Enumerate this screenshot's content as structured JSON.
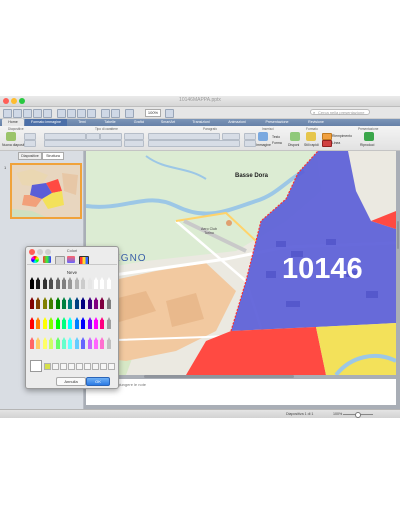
{
  "window": {
    "title": "10146MAPPA.pptx",
    "close_color": "#ff5f57",
    "minimize_color": "#febc2e",
    "zoom_color": "#28c840"
  },
  "toolbar": {
    "zoom_value": "100%",
    "search_placeholder": "Cerca nella presentazione",
    "search_icon": "search-icon"
  },
  "ribbon_tabs": [
    {
      "label": "Home",
      "state": "active"
    },
    {
      "label": "Formato immagine",
      "state": "selected"
    },
    {
      "label": "Temi",
      "state": "normal"
    },
    {
      "label": "Tabelle",
      "state": "normal"
    },
    {
      "label": "Grafici",
      "state": "normal"
    },
    {
      "label": "SmartArt",
      "state": "normal"
    },
    {
      "label": "Transizioni",
      "state": "normal"
    },
    {
      "label": "Animazioni",
      "state": "normal"
    },
    {
      "label": "Presentazione",
      "state": "normal"
    },
    {
      "label": "Revisione",
      "state": "normal"
    }
  ],
  "ribbon": {
    "group_diapositive": "Diapositive",
    "group_font": "Tipo di carattere",
    "group_paragraph": "Paragrafo",
    "group_insert": "Inserisci",
    "group_format": "Formato",
    "group_presentation": "Presentazione",
    "new_slide": "Nuova diapositiva",
    "picture": "Immagine",
    "text_box": "Testo",
    "shape": "Forma",
    "arrange": "Disponi",
    "quick_styles": "Stili rapidi",
    "fill": "Riempimento",
    "line": "Linea",
    "play": "Riproduci"
  },
  "left_panel": {
    "tabs": [
      "Diapositive",
      "Struttura"
    ],
    "active_tab": "Struttura",
    "slide_number": "1"
  },
  "map": {
    "postal_code": "10146",
    "labels": [
      {
        "text": "Basse Dora"
      },
      {
        "text": "LLEGNO"
      },
      {
        "text": "Aero Club Torino"
      }
    ],
    "colors": {
      "zone_blue": "#5b5ed8",
      "zone_red": "#ff4a42",
      "zone_yellow": "#f3e15a",
      "park": "#d9ecd2",
      "urban": "#f2c9a0"
    }
  },
  "notes": {
    "placeholder": "Fate clic per aggiungere le note"
  },
  "status": {
    "slide_indicator": "Diapositiva 1 di 1",
    "zoom": "100%"
  },
  "color_picker": {
    "title": "Colori",
    "mode_icons": [
      "color-wheel-icon",
      "color-sliders-icon",
      "color-palettes-icon",
      "image-palettes-icon",
      "crayons-icon"
    ],
    "color_name": "Neve",
    "cancel_label": "Annulla",
    "ok_label": "OK",
    "selected_color": "#ffffff",
    "crayon_colors": [
      "#000000",
      "#1a1a1a",
      "#333333",
      "#4d4d4d",
      "#666666",
      "#808080",
      "#999999",
      "#b3b3b3",
      "#cccccc",
      "#e6e6e6",
      "#ffffff",
      "#ffffff",
      "#ffffff",
      "#800000",
      "#804000",
      "#808000",
      "#408000",
      "#008000",
      "#008040",
      "#008080",
      "#004080",
      "#000080",
      "#400080",
      "#800080",
      "#800040",
      "#808080",
      "#ff0000",
      "#ff8000",
      "#ffff00",
      "#80ff00",
      "#00ff00",
      "#00ff80",
      "#00ffff",
      "#0080ff",
      "#0000ff",
      "#8000ff",
      "#ff00ff",
      "#ff0080",
      "#a0a0a0",
      "#ff6666",
      "#ffcc66",
      "#ffff66",
      "#ccff66",
      "#66ff66",
      "#66ffcc",
      "#66ffff",
      "#66ccff",
      "#6666ff",
      "#cc66ff",
      "#ff66ff",
      "#ff6fcf",
      "#c0c0c0"
    ]
  }
}
